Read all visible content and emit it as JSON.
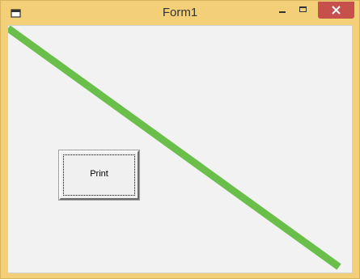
{
  "window": {
    "title": "Form1"
  },
  "icons": {
    "app": "form-window-icon",
    "minimize": "minimize-icon",
    "maximize": "maximize-icon",
    "close": "close-icon"
  },
  "colors": {
    "titlebar": "#f3cf78",
    "close_button": "#c7504c",
    "client_background": "#f2f2f2",
    "line": "#6abf4b"
  },
  "form": {
    "print_button_label": "Print"
  }
}
